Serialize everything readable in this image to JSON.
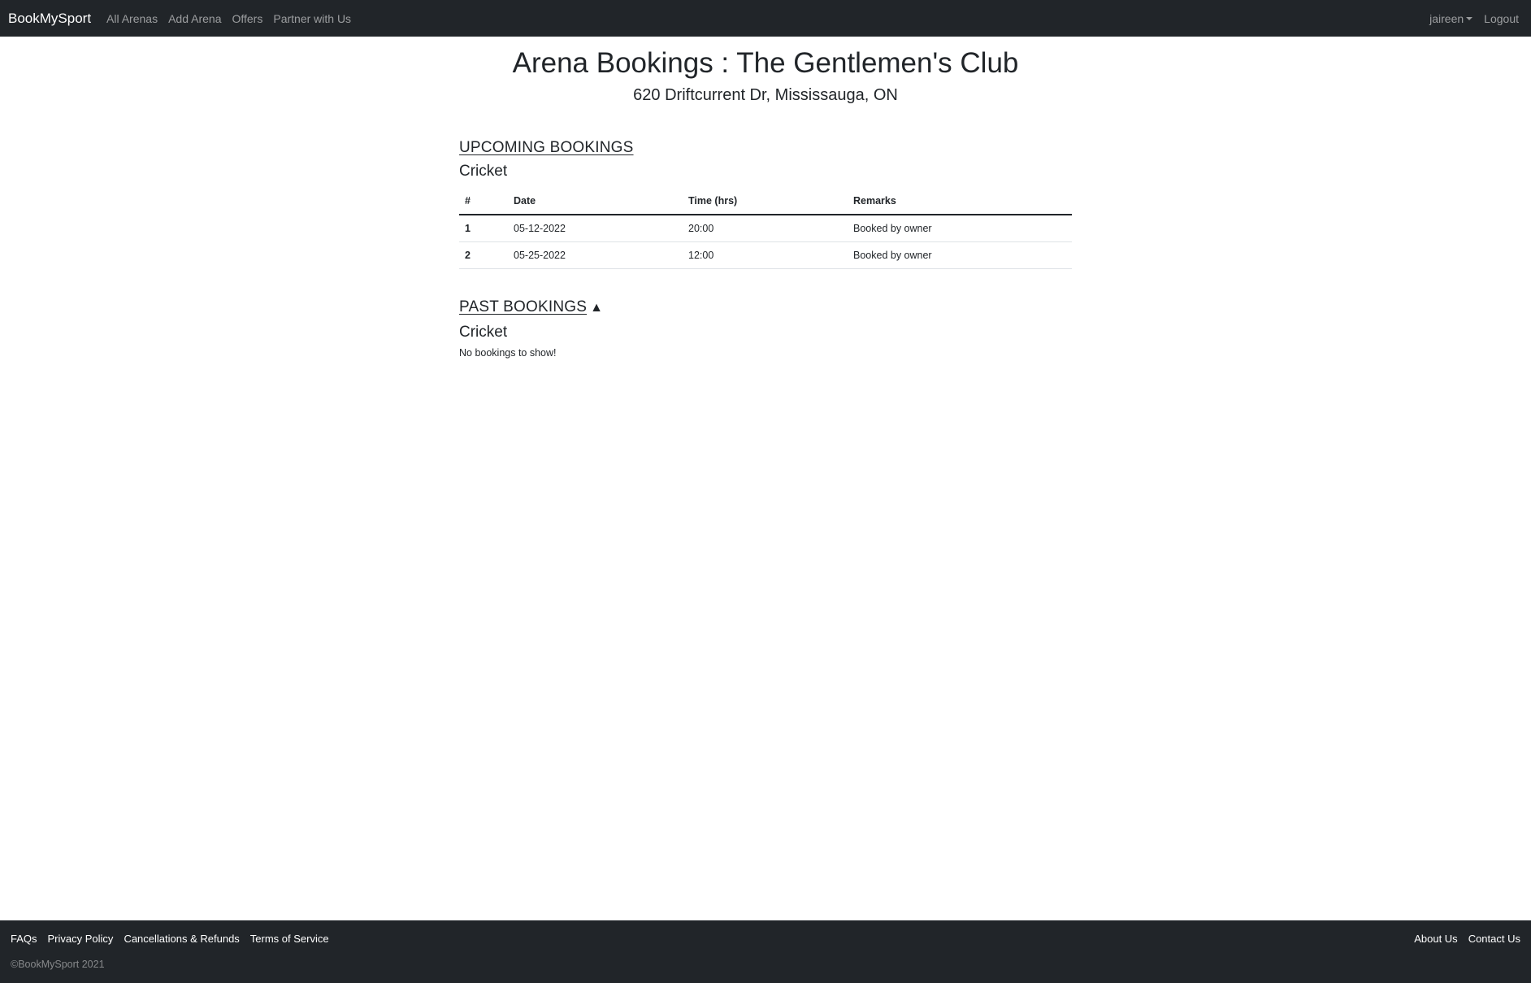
{
  "navbar": {
    "brand": "BookMySport",
    "links": [
      "All Arenas",
      "Add Arena",
      "Offers",
      "Partner with Us"
    ],
    "user": "jaireen",
    "logout": "Logout"
  },
  "page": {
    "title": "Arena Bookings : The Gentlemen's Club",
    "address": "620 Driftcurrent Dr, Mississauga, ON"
  },
  "upcoming": {
    "heading": "UPCOMING BOOKINGS",
    "sport": "Cricket",
    "columns": [
      "#",
      "Date",
      "Time (hrs)",
      "Remarks"
    ],
    "rows": [
      {
        "num": "1",
        "date": "05-12-2022",
        "time": "20:00",
        "remarks": "Booked by owner"
      },
      {
        "num": "2",
        "date": "05-25-2022",
        "time": "12:00",
        "remarks": "Booked by owner"
      }
    ]
  },
  "past": {
    "heading": "PAST BOOKINGS",
    "sort_glyph": "▲",
    "sport": "Cricket",
    "empty_message": "No bookings to show!"
  },
  "footer": {
    "left_links": [
      "FAQs",
      "Privacy Policy",
      "Cancellations & Refunds",
      "Terms of Service"
    ],
    "right_links": [
      "About Us",
      "Contact Us"
    ],
    "copyright": "©BookMySport 2021"
  }
}
